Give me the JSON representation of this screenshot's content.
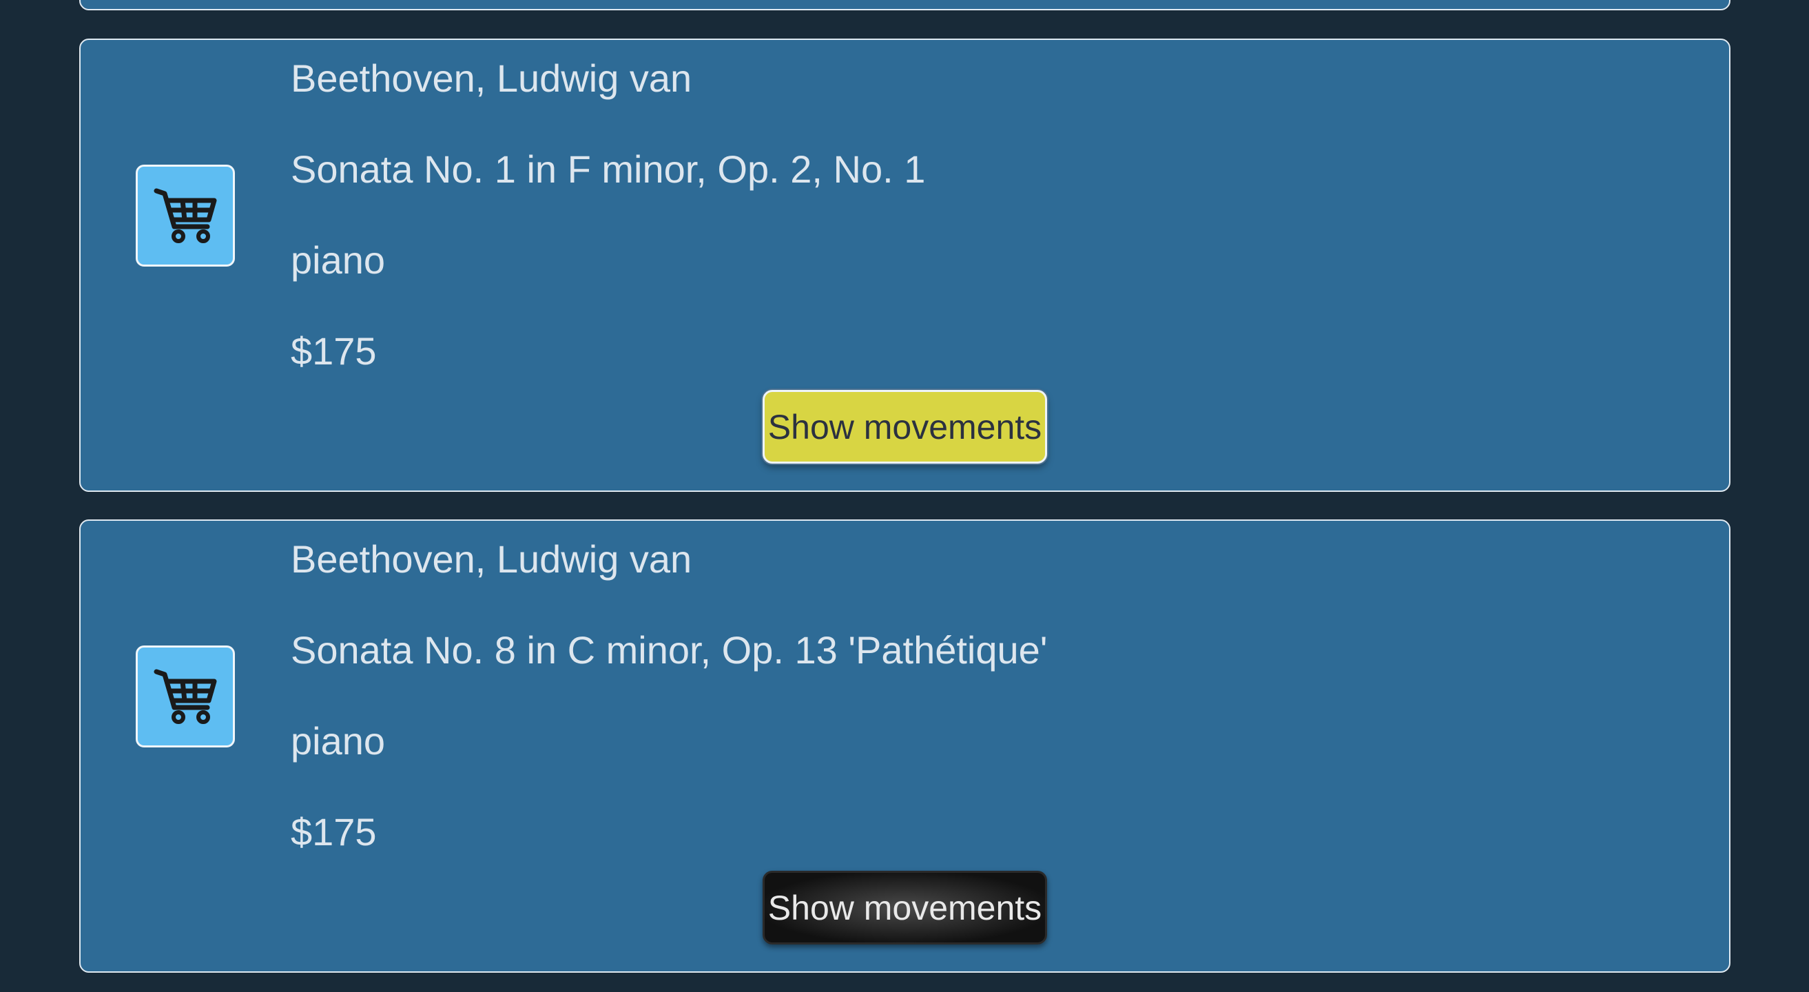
{
  "colors": {
    "page_background": "#182a38",
    "card_background": "#2e6b96",
    "card_border": "#dfe9f1",
    "cart_button": "#5ebdf2",
    "show_movements_active": "#d8d543",
    "show_movements_default": "#111111",
    "text": "#dde6ee"
  },
  "icons": {
    "cart": "shopping-cart-icon"
  },
  "items": [
    {
      "composer": "Beethoven, Ludwig van",
      "title": "Sonata No. 1 in F minor, Op. 2, No. 1",
      "instrument": "piano",
      "price": "$175",
      "show_movements_label": "Show movements"
    },
    {
      "composer": "Beethoven, Ludwig van",
      "title": "Sonata No. 8 in C minor, Op. 13 'Pathétique'",
      "instrument": "piano",
      "price": "$175",
      "show_movements_label": "Show movements"
    }
  ]
}
